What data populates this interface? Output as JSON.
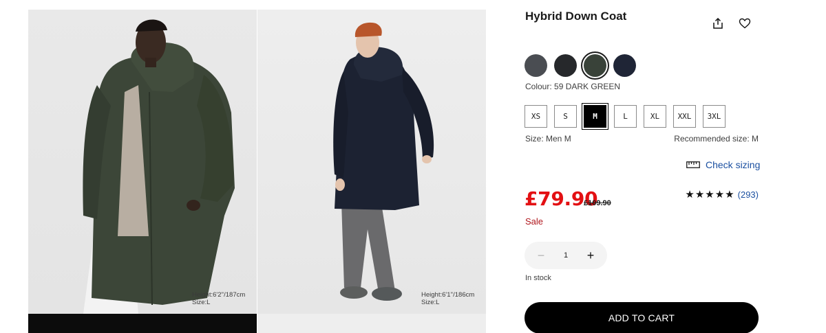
{
  "product": {
    "title": "Hybrid Down Coat"
  },
  "actions": {
    "share_icon": "share-icon",
    "favorite_icon": "heart-icon"
  },
  "gallery": {
    "photos": [
      {
        "coat_color": "#3c4638",
        "model_note_line1": "Height:6'2''/187cm",
        "model_note_line2": "Size:L"
      },
      {
        "coat_color": "#1c2232",
        "model_note_line1": "Height:6'1''/186cm",
        "model_note_line2": "Size:L"
      }
    ]
  },
  "colours": {
    "swatches": [
      {
        "name": "grey",
        "hex": "#4a4d52"
      },
      {
        "name": "black",
        "hex": "#26282b"
      },
      {
        "name": "dark green",
        "hex": "#394239"
      },
      {
        "name": "navy",
        "hex": "#1f2536"
      }
    ],
    "selected_index": 2,
    "label": "Colour: 59 DARK GREEN"
  },
  "sizes": {
    "options": [
      "XS",
      "S",
      "M",
      "L",
      "XL",
      "XXL",
      "3XL"
    ],
    "selected": "M",
    "size_label": "Size: Men M",
    "recommended_label": "Recommended size: M",
    "check_sizing": "Check sizing"
  },
  "pricing": {
    "price": "£79.90",
    "original_price": "£109.90",
    "sale_label": "Sale"
  },
  "rating": {
    "stars": "★★★★★",
    "stars_value": 5,
    "count": "(293)"
  },
  "quantity": {
    "value": "1",
    "minus": "−",
    "plus": "+"
  },
  "stock": "In stock",
  "cart_button": "ADD TO CART"
}
